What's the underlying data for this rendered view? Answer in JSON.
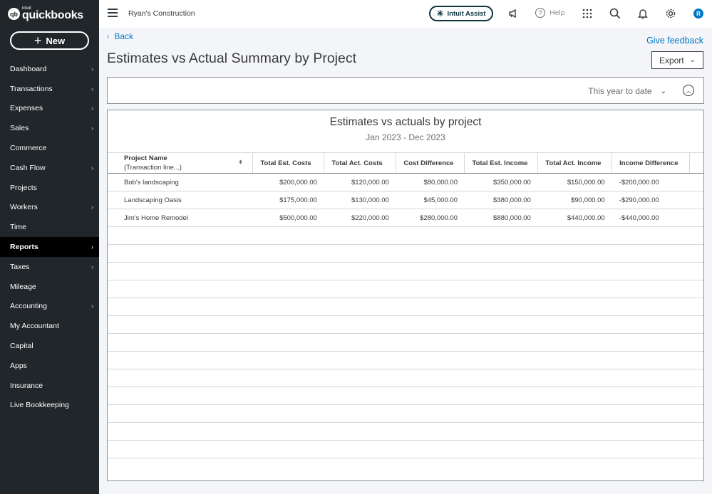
{
  "app": {
    "logo_small": "intuit",
    "logo_word": "quickbooks",
    "logo_badge": "qb"
  },
  "sidebar": {
    "new_label": "New",
    "items": [
      {
        "label": "Dashboard",
        "chevron": true
      },
      {
        "label": "Transactions",
        "chevron": true
      },
      {
        "label": "Expenses",
        "chevron": true
      },
      {
        "label": "Sales",
        "chevron": true
      },
      {
        "label": "Commerce",
        "chevron": false
      },
      {
        "label": "Cash Flow",
        "chevron": true
      },
      {
        "label": "Projects",
        "chevron": false
      },
      {
        "label": "Workers",
        "chevron": true
      },
      {
        "label": "Time",
        "chevron": false
      },
      {
        "label": "Reports",
        "chevron": true,
        "active": true
      },
      {
        "label": "Taxes",
        "chevron": true
      },
      {
        "label": "Mileage",
        "chevron": false
      },
      {
        "label": "Accounting",
        "chevron": true
      },
      {
        "label": "My Accountant",
        "chevron": false
      },
      {
        "label": "Capital",
        "chevron": false
      },
      {
        "label": "Apps",
        "chevron": false
      },
      {
        "label": "Insurance",
        "chevron": false
      },
      {
        "label": "Live Bookkeeping",
        "chevron": false
      }
    ]
  },
  "topbar": {
    "company": "Ryan's Construction",
    "assist_label": "Intuit Assist",
    "help_label": "Help",
    "avatar_initial": "R"
  },
  "page": {
    "back_label": "Back",
    "feedback_label": "Give feedback",
    "title": "Estimates vs Actual Summary by Project",
    "export_label": "Export",
    "date_range": "This year to date"
  },
  "report": {
    "title": "Estimates vs actuals by project",
    "subtitle": "Jan 2023 - Dec 2023",
    "columns": {
      "project": "Project Name",
      "project_sub": "(Transaction line...)",
      "est_costs": "Total Est. Costs",
      "act_costs": "Total Act. Costs",
      "cost_diff": "Cost Difference",
      "est_income": "Total Est. Income",
      "act_income": "Total Act. Income",
      "income_diff": "Income Difference"
    },
    "rows": [
      {
        "project": "Bob's landscaping",
        "est_costs": "$200,000.00",
        "act_costs": "$120,000.00",
        "cost_diff": "$80,000.00",
        "est_income": "$350,000.00",
        "act_income": "$150,000.00",
        "income_diff": "-$200,000.00"
      },
      {
        "project": "Landscaping Oasis",
        "est_costs": "$175,000.00",
        "act_costs": "$130,000.00",
        "cost_diff": "$45,000.00",
        "est_income": "$380,000.00",
        "act_income": "$90,000.00",
        "income_diff": "-$290,000.00"
      },
      {
        "project": "Jim's Home Remodel",
        "est_costs": "$500,000.00",
        "act_costs": "$220,000.00",
        "cost_diff": "$280,000.00",
        "est_income": "$880,000.00",
        "act_income": "$440,000.00",
        "income_diff": "-$440,000.00"
      }
    ],
    "empty_rows": 13
  },
  "colors": {
    "accent": "#0077c5",
    "sidebar_bg": "#21262a",
    "active_bg": "#000000"
  }
}
